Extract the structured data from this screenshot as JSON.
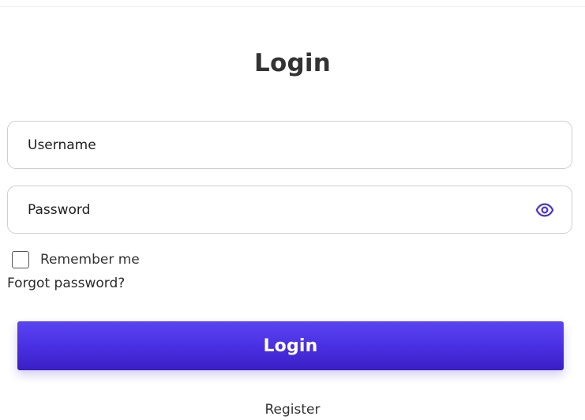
{
  "header": {
    "title": "Login"
  },
  "form": {
    "username": {
      "placeholder": "Username",
      "value": ""
    },
    "password": {
      "placeholder": "Password",
      "value": "",
      "toggle_icon": "eye-icon"
    },
    "remember_me": {
      "label": "Remember me",
      "checked": false
    },
    "forgot_password_label": "Forgot password?",
    "submit_label": "Login"
  },
  "footer": {
    "register_label": "Register"
  },
  "colors": {
    "accent": "#4a30e4",
    "icon": "#4a33d1"
  }
}
